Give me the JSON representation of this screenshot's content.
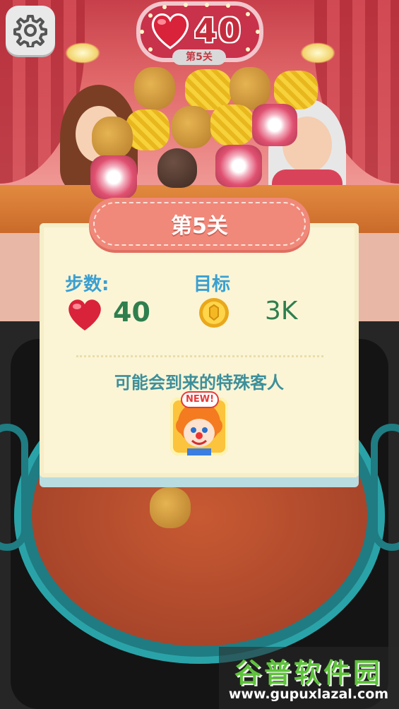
{
  "hud": {
    "moves": "40",
    "level_tag": "第5关",
    "settings_icon": "gear-icon",
    "moves_icon": "heart-icon"
  },
  "dialog": {
    "title": "第5关",
    "steps_label": "步数:",
    "steps_value": "40",
    "goal_label": "目标",
    "goal_value": "3K",
    "goal_icon": "coin-icon",
    "special_guest_text": "可能会到来的特殊客人",
    "guest_badge": "NEW!",
    "guest_icon": "clown-avatar-icon"
  },
  "watermark": {
    "title": "谷普软件园",
    "url": "www.gupuxlazal.com"
  },
  "colors": {
    "title_bar": "#f0897a",
    "dialog_bg": "#fbf5d6",
    "label_blue": "#3a9fd1",
    "value_green": "#2f7f4e",
    "heart_red": "#d9233a"
  }
}
